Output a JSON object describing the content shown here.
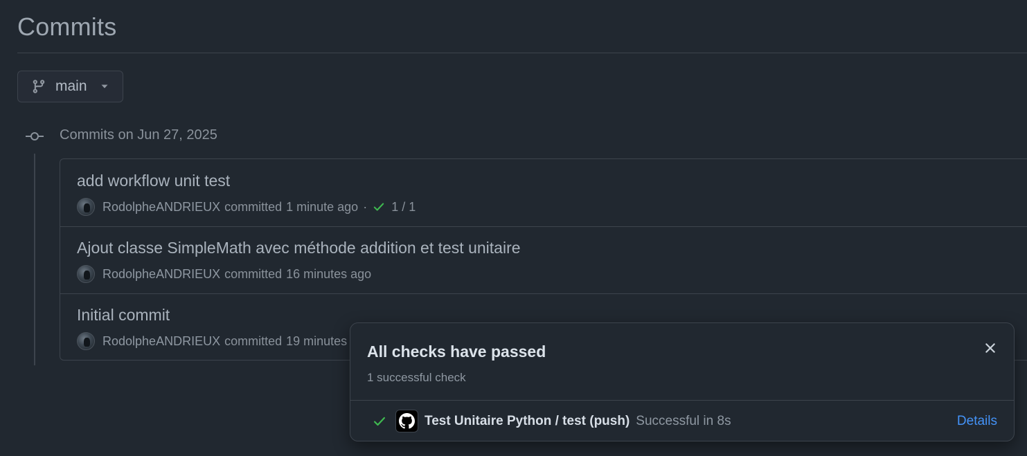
{
  "page": {
    "title": "Commits"
  },
  "branch": {
    "name": "main"
  },
  "group": {
    "heading": "Commits on Jun 27, 2025"
  },
  "commits": [
    {
      "message": "add workflow unit test",
      "author": "RodolpheANDRIEUX",
      "action": "committed",
      "time": "1 minute ago",
      "separator": "·",
      "checks": "1 / 1"
    },
    {
      "message": "Ajout classe SimpleMath avec méthode addition et test unitaire",
      "author": "RodolpheANDRIEUX",
      "action": "committed",
      "time": "16 minutes ago"
    },
    {
      "message": "Initial commit",
      "author": "RodolpheANDRIEUX",
      "action": "committed",
      "time": "19 minutes ago"
    }
  ],
  "popover": {
    "title": "All checks have passed",
    "subtitle": "1 successful check",
    "check": {
      "name": "Test Unitaire Python / test (push)",
      "status": "Successful in 8s",
      "details_label": "Details",
      "icon": "github-icon"
    }
  },
  "colors": {
    "background": "#212830",
    "border": "#3d444d",
    "success": "#3fb950",
    "link": "#4493f8"
  }
}
